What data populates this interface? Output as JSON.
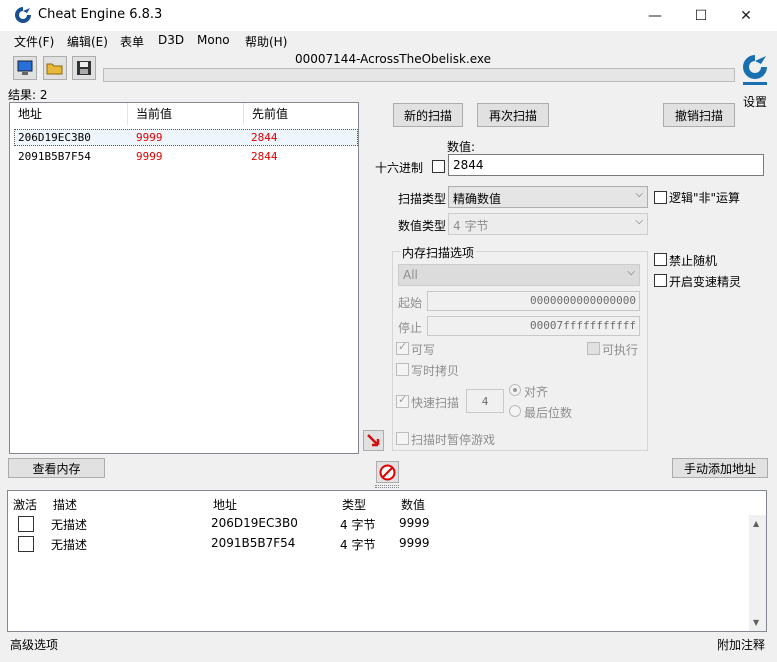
{
  "window": {
    "title": "Cheat Engine 6.8.3",
    "minimize": "—",
    "maximize": "☐",
    "close": "✕"
  },
  "menu": [
    "文件(F)",
    "编辑(E)",
    "表单",
    "D3D",
    "Mono",
    "帮助(H)"
  ],
  "toolbar": {
    "process": "00007144-AcrossTheObelisk.exe",
    "settings": "设置"
  },
  "results": {
    "count_label": "结果: 2",
    "columns": [
      "地址",
      "当前值",
      "先前值"
    ],
    "rows": [
      {
        "address": "206D19EC3B0",
        "current": "9999",
        "previous": "2844"
      },
      {
        "address": "2091B5B7F54",
        "current": "9999",
        "previous": "2844"
      }
    ]
  },
  "scan": {
    "new_scan": "新的扫描",
    "next_scan": "再次扫描",
    "undo_scan": "撤销扫描",
    "value_label": "数值:",
    "hex_label": "十六进制",
    "value": "2844",
    "scan_type_label": "扫描类型",
    "scan_type": "精确数值",
    "value_type_label": "数值类型",
    "value_type": "4 字节",
    "logic_not": "逻辑\"非\"运算",
    "no_random": "禁止随机",
    "speedhack": "开启变速精灵"
  },
  "memory": {
    "title": "内存扫描选项",
    "region": "All",
    "start_label": "起始",
    "start": "0000000000000000",
    "stop_label": "停止",
    "stop": "00007fffffffffff",
    "writable": "可写",
    "executable": "可执行",
    "copy_on_write": "写时拷贝",
    "fast_scan": "快速扫描",
    "fast_value": "4",
    "align": "对齐",
    "last_digits": "最后位数",
    "pause_game": "扫描时暂停游戏"
  },
  "buttons": {
    "view_memory": "查看内存",
    "add_address": "手动添加地址"
  },
  "addresses": {
    "columns": [
      "激活",
      "描述",
      "地址",
      "类型",
      "数值"
    ],
    "rows": [
      {
        "description": "无描述",
        "address": "206D19EC3B0",
        "type": "4 字节",
        "value": "9999"
      },
      {
        "description": "无描述",
        "address": "2091B5B7F54",
        "type": "4 字节",
        "value": "9999"
      }
    ]
  },
  "status": {
    "left": "高级选项",
    "right": "附加注释"
  }
}
